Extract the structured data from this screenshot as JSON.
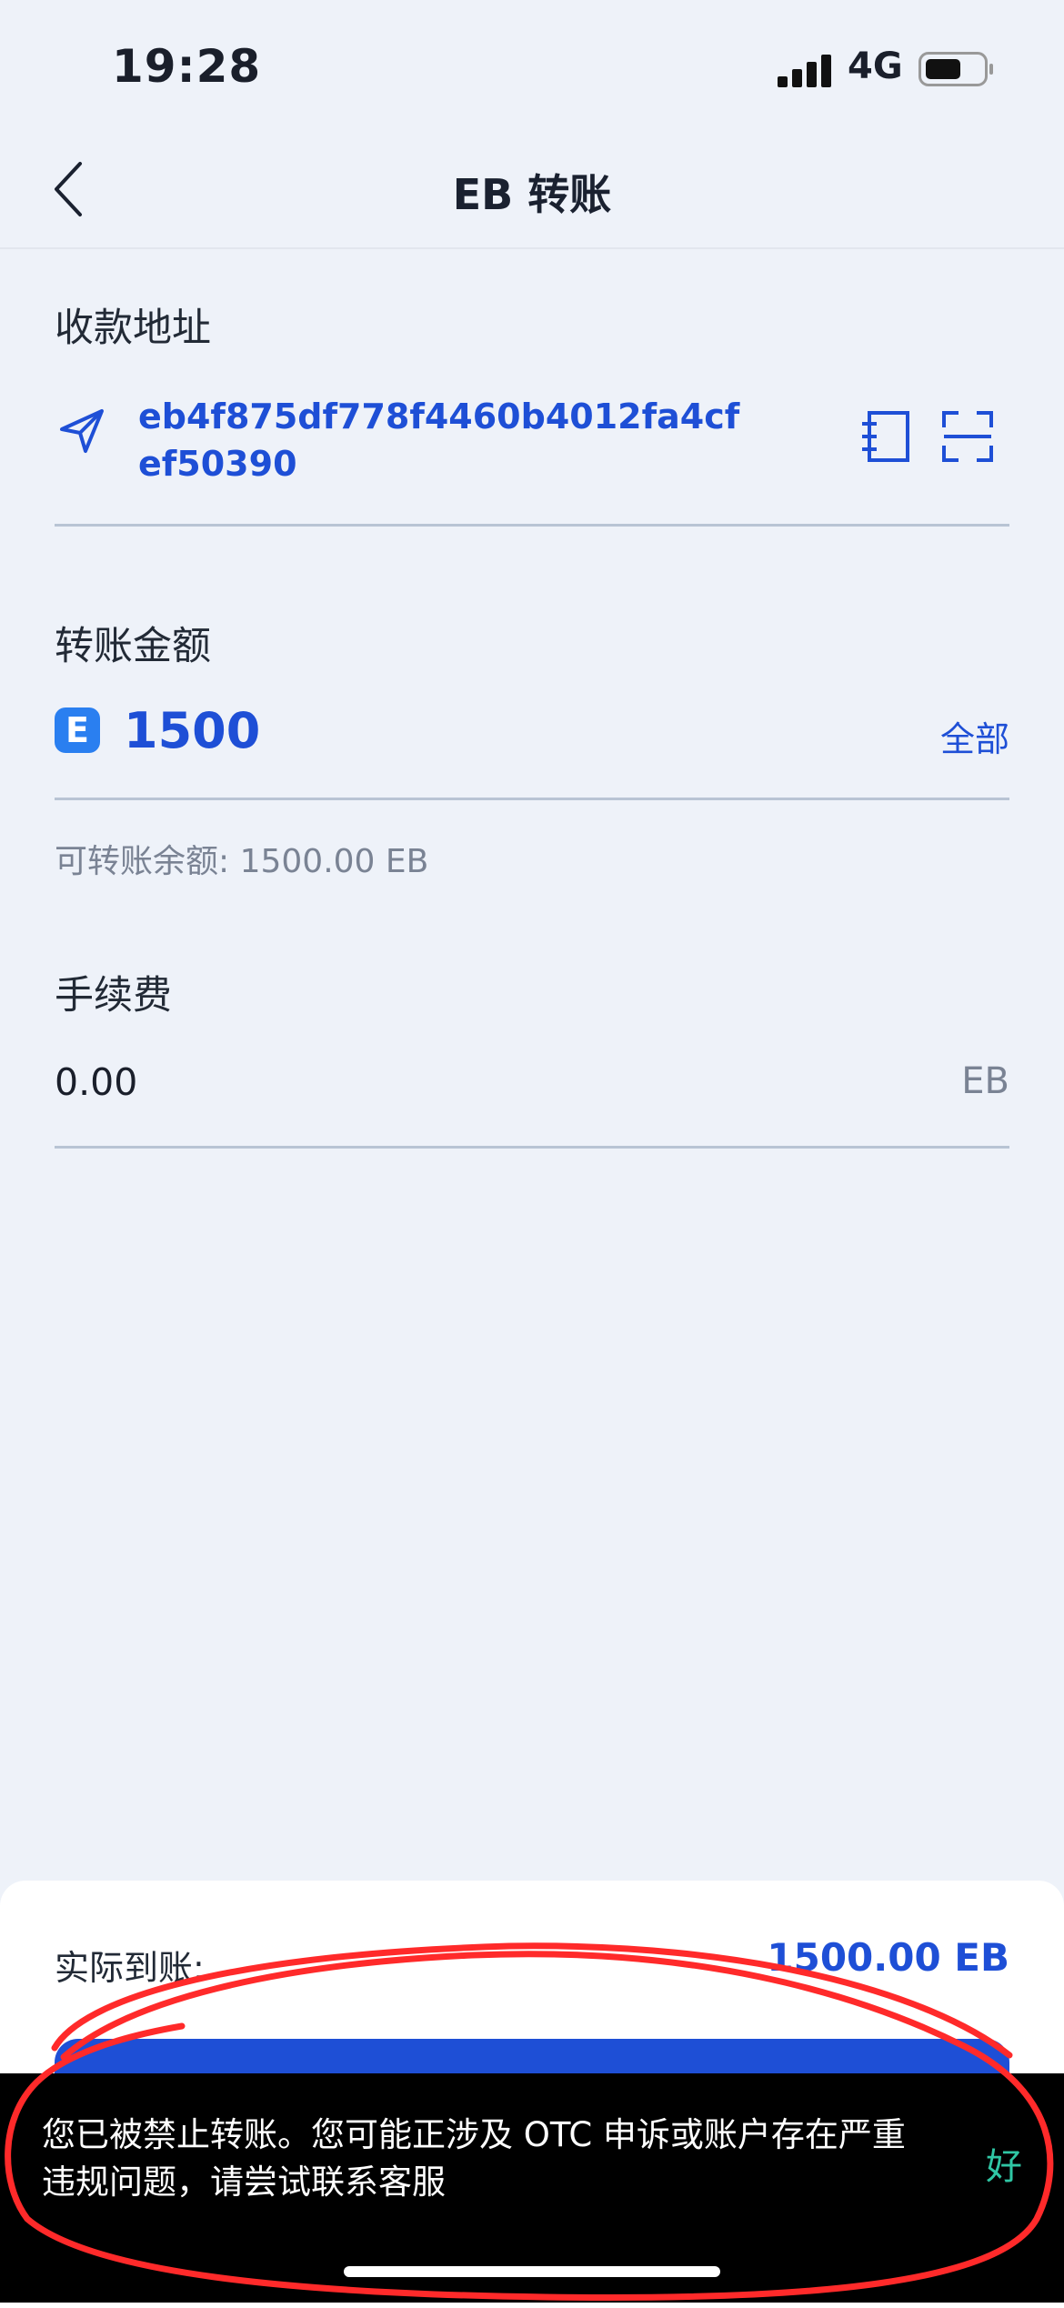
{
  "status_bar": {
    "time": "19:28",
    "network": "4G"
  },
  "nav": {
    "title": "EB 转账"
  },
  "recipient": {
    "label": "收款地址",
    "address": "eb4f875df778f4460b4012fa4cfef50390"
  },
  "amount": {
    "label": "转账金额",
    "coin_icon_text": "E",
    "value": "1500",
    "all_button": "全部",
    "available": "可转账余额: 1500.00 EB"
  },
  "fee": {
    "label": "手续费",
    "value": "0.00",
    "unit": "EB"
  },
  "bottom": {
    "actual_label": "实际到账:",
    "actual_value": "1500.00 EB"
  },
  "toast": {
    "message": "您已被禁止转账。您可能正涉及 OTC 申诉或账户存在严重违规问题，请尝试联系客服",
    "action": "好"
  },
  "colors": {
    "accent": "#1e4fd6",
    "background": "#eef2f9",
    "toast_action": "#2fc6a4",
    "annotation": "#ff2a2a"
  }
}
